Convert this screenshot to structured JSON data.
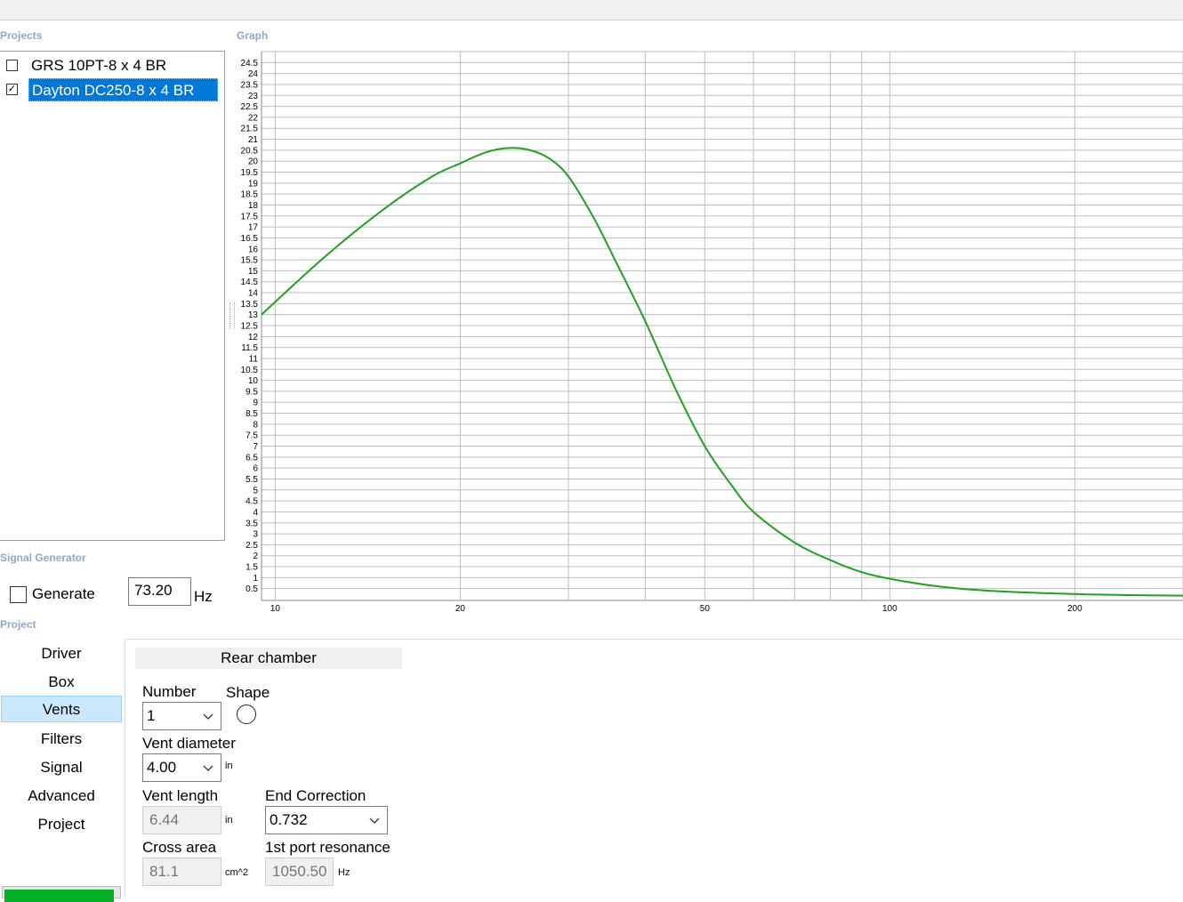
{
  "sections": {
    "projects": "Projects",
    "graph": "Graph",
    "signal_generator": "Signal Generator",
    "project": "Project"
  },
  "projects": [
    {
      "label": "GRS 10PT-8 x 4 BR",
      "checked": false,
      "selected": false
    },
    {
      "label": "Dayton DC250-8 x 4 BR",
      "checked": true,
      "selected": true
    }
  ],
  "signal_generator": {
    "generate_label": "Generate",
    "generate_checked": false,
    "frequency": "73.20",
    "unit": "Hz"
  },
  "nav": {
    "items": [
      "Driver",
      "Box",
      "Vents",
      "Filters",
      "Signal",
      "Advanced",
      "Project"
    ],
    "active": "Vents",
    "progress": 0.96
  },
  "vents": {
    "title": "Rear chamber",
    "number_label": "Number",
    "number_value": "1",
    "shape_label": "Shape",
    "shape": "circle",
    "diameter_label": "Vent diameter",
    "diameter_value": "4.00",
    "diameter_unit": "in",
    "length_label": "Vent length",
    "length_value": "6.44",
    "length_unit": "in",
    "end_correction_label": "End Correction",
    "end_correction_value": "0.732",
    "cross_area_label": "Cross area",
    "cross_area_value": "81.1",
    "cross_area_unit": "cm^2",
    "port_resonance_label": "1st port resonance",
    "port_resonance_value": "1050.50",
    "port_resonance_unit": "Hz"
  },
  "colors": {
    "curve": "#22a022",
    "selection": "#0078d7",
    "section_label": "#8fa7c6",
    "grid": "#bdbdbd",
    "progress": "#06b025"
  },
  "chart_data": {
    "type": "line",
    "title": "",
    "xlabel": "",
    "ylabel": "",
    "x_scale": "log",
    "xlim": [
      9.5,
      300
    ],
    "ylim": [
      0,
      25
    ],
    "grid": true,
    "x_tick_labels": [
      10,
      20,
      50,
      100,
      200
    ],
    "y_tick_labels": [
      0.5,
      1,
      1.5,
      2,
      2.5,
      3,
      3.5,
      4,
      4.5,
      5,
      5.5,
      6,
      6.5,
      7,
      7.5,
      8,
      8.5,
      9,
      9.5,
      10,
      10.5,
      11,
      11.5,
      12,
      12.5,
      13,
      13.5,
      14,
      14.5,
      15,
      15.5,
      16,
      16.5,
      17,
      17.5,
      18,
      18.5,
      19,
      19.5,
      20,
      20.5,
      21,
      21.5,
      22,
      22.5,
      23,
      23.5,
      24,
      24.5
    ],
    "series": [
      {
        "color": "#22a022",
        "x": [
          9.5,
          12,
          15,
          18,
          20,
          22,
          24,
          26,
          28,
          30,
          33,
          36,
          40,
          45,
          50,
          55,
          60,
          70,
          80,
          90,
          100,
          120,
          150,
          200,
          250,
          300
        ],
        "y": [
          13.0,
          15.6,
          17.8,
          19.3,
          19.9,
          20.4,
          20.6,
          20.5,
          20.1,
          19.3,
          17.4,
          15.3,
          12.7,
          9.5,
          7.0,
          5.3,
          4.0,
          2.6,
          1.8,
          1.25,
          0.95,
          0.6,
          0.38,
          0.25,
          0.2,
          0.18
        ]
      }
    ]
  }
}
